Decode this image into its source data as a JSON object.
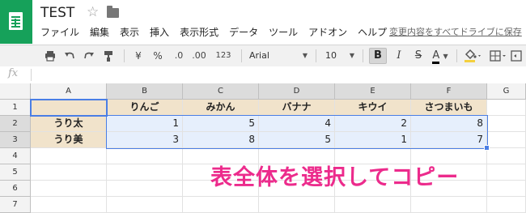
{
  "app": {
    "title": "TEST",
    "menu": [
      "ファイル",
      "編集",
      "表示",
      "挿入",
      "表示形式",
      "データ",
      "ツール",
      "アドオン",
      "ヘルプ"
    ],
    "save_status": "変更内容をすべてドライブに保存"
  },
  "toolbar": {
    "currency": "¥",
    "percent": "%",
    "decimal_decrease": ".0",
    "decimal_increase": ".00",
    "format_more": "123",
    "font": "Arial",
    "font_size": "10",
    "bold": "B",
    "italic": "I",
    "strike": "S",
    "text_color_letter": "A"
  },
  "formula_bar": {
    "fx_label": "fx",
    "value": ""
  },
  "sheet": {
    "columns": [
      "A",
      "B",
      "C",
      "D",
      "E",
      "F",
      "G"
    ],
    "rows": [
      "1",
      "2",
      "3",
      "4",
      "5",
      "6",
      "7"
    ],
    "header_row": [
      "",
      "りんご",
      "みかん",
      "バナナ",
      "キウイ",
      "さつまいも"
    ],
    "data_rows": [
      {
        "label": "うり太",
        "values": [
          "1",
          "5",
          "4",
          "2",
          "8"
        ]
      },
      {
        "label": "うり美",
        "values": [
          "3",
          "8",
          "5",
          "1",
          "7"
        ]
      }
    ]
  },
  "annotation": "表全体を選択してコピー",
  "colors": {
    "brand_green": "#16a15a",
    "header_fill": "#f1e3cb",
    "data_fill": "#e6effc",
    "selection": "#4a7ee5",
    "annotation": "#ec2b8c"
  }
}
